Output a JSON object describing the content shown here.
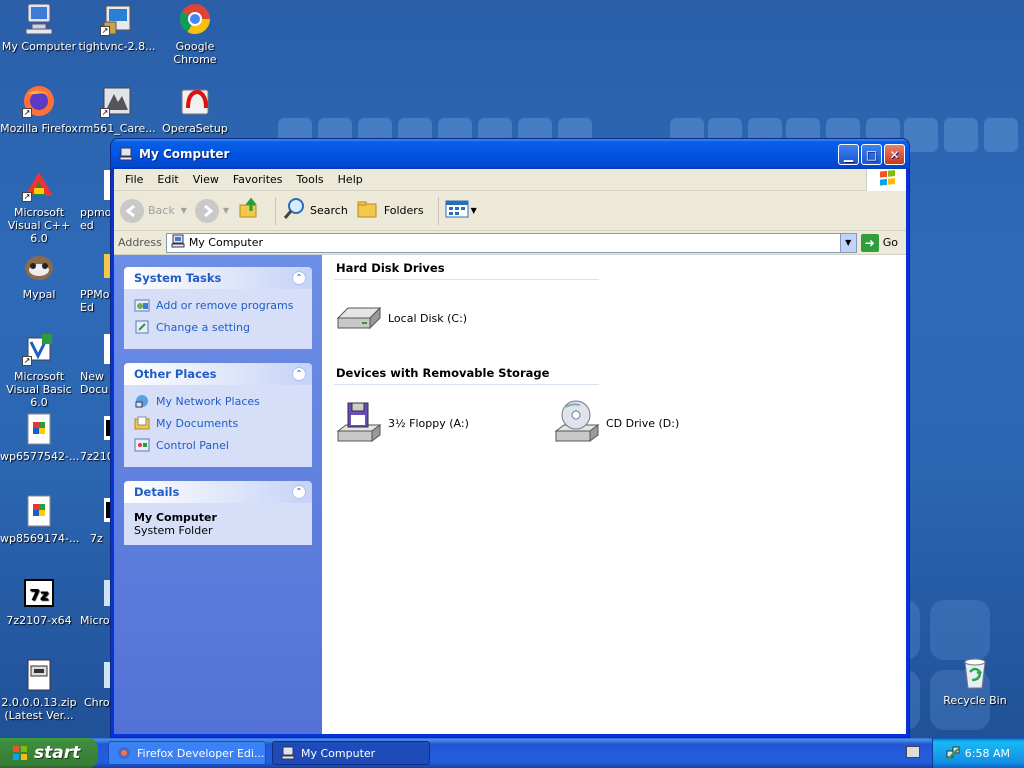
{
  "desktop": {
    "icons": [
      {
        "label": "My Computer"
      },
      {
        "label": "tightvnc-2.8..."
      },
      {
        "label": "Google Chrome"
      },
      {
        "label": "Mozilla Firefox"
      },
      {
        "label": "rm561_Care..."
      },
      {
        "label": "OperaSetup"
      },
      {
        "label": "Microsoft Visual C++ 6.0"
      },
      {
        "label": "ppmod... ed"
      },
      {
        "label": "Mypal"
      },
      {
        "label": "PPMod... Ed"
      },
      {
        "label": "Microsoft Visual Basic 6.0"
      },
      {
        "label": "New Docu"
      },
      {
        "label": "wp6577542-..."
      },
      {
        "label": "7z210"
      },
      {
        "label": "wp8569174-..."
      },
      {
        "label": "7z"
      },
      {
        "label": "7z2107-x64"
      },
      {
        "label": "Micros"
      },
      {
        "label": "2.0.0.0.13.zip (Latest Ver..."
      },
      {
        "label": "Chron"
      },
      {
        "label": "Recycle Bin"
      }
    ]
  },
  "window": {
    "title": "My Computer",
    "menu": [
      "File",
      "Edit",
      "View",
      "Favorites",
      "Tools",
      "Help"
    ],
    "toolbar": {
      "back": "Back",
      "search": "Search",
      "folders": "Folders"
    },
    "address": {
      "label": "Address",
      "value": "My Computer",
      "go": "Go"
    },
    "left_panels": {
      "system_tasks": {
        "title": "System Tasks",
        "items": [
          "Add or remove programs",
          "Change a setting"
        ]
      },
      "other_places": {
        "title": "Other Places",
        "items": [
          "My Network Places",
          "My Documents",
          "Control Panel"
        ]
      },
      "details": {
        "title": "Details",
        "name": "My Computer",
        "type": "System Folder"
      }
    },
    "sections": {
      "hard_disks": {
        "title": "Hard Disk Drives",
        "items": [
          "Local Disk (C:)"
        ]
      },
      "removable": {
        "title": "Devices with Removable Storage",
        "items": [
          "3½ Floppy (A:)",
          "CD Drive (D:)"
        ]
      }
    }
  },
  "taskbar": {
    "start": "start",
    "tasks": [
      "Firefox Developer Edi...",
      "My Computer"
    ],
    "clock": "6:58 AM"
  }
}
